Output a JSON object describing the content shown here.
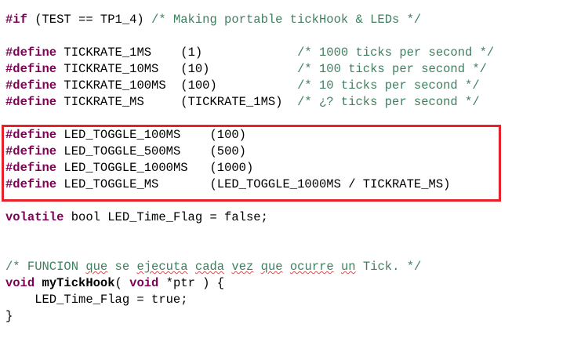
{
  "code": {
    "line_if": {
      "kw": "#if",
      "text": " (TEST == TP1_4) ",
      "comment": "/* Making portable tickHook & LEDs */"
    },
    "tick_defines": [
      {
        "kw": "#define",
        "name": " TICKRATE_1MS    ",
        "value": "(1)             ",
        "comment": "/* 1000 ticks per second */"
      },
      {
        "kw": "#define",
        "name": " TICKRATE_10MS   ",
        "value": "(10)            ",
        "comment": "/* 100 ticks per second */"
      },
      {
        "kw": "#define",
        "name": " TICKRATE_100MS  ",
        "value": "(100)           ",
        "comment": "/* 10 ticks per second */"
      },
      {
        "kw": "#define",
        "name": " TICKRATE_MS     ",
        "value": "(TICKRATE_1MS)  ",
        "comment": "/* ¿? ticks per second */"
      }
    ],
    "led_defines": [
      {
        "kw": "#define",
        "name": " LED_TOGGLE_100MS    ",
        "value": "(100)"
      },
      {
        "kw": "#define",
        "name": " LED_TOGGLE_500MS    ",
        "value": "(500)"
      },
      {
        "kw": "#define",
        "name": " LED_TOGGLE_1000MS   ",
        "value": "(1000)"
      },
      {
        "kw": "#define",
        "name": " LED_TOGGLE_MS       ",
        "value": "(LED_TOGGLE_1000MS / TICKRATE_MS)"
      }
    ],
    "volatile_line": {
      "kw": "volatile",
      "text": " bool LED_Time_Flag = false;"
    },
    "comment_line": {
      "open": "/* FUNCION ",
      "w_que1": "que",
      "s1": " se ",
      "w_ejecuta": "ejecuta",
      "s2": " ",
      "w_cada": "cada",
      "s3": " ",
      "w_vez": "vez",
      "s4": " ",
      "w_que2": "que",
      "s5": " ",
      "w_ocurre": "ocurre",
      "s6": " ",
      "w_un": "un",
      "close": " Tick. */"
    },
    "func_line": {
      "kw1": "void",
      "name": " myTickHook",
      "p1": "( ",
      "kw2": "void",
      "rest": " *ptr ) {"
    },
    "body_line": "    LED_Time_Flag = true;",
    "close_brace": "}"
  },
  "colors": {
    "keyword": "#7f0055",
    "comment": "#3f7f5f",
    "highlight_border": "#e8202a"
  }
}
